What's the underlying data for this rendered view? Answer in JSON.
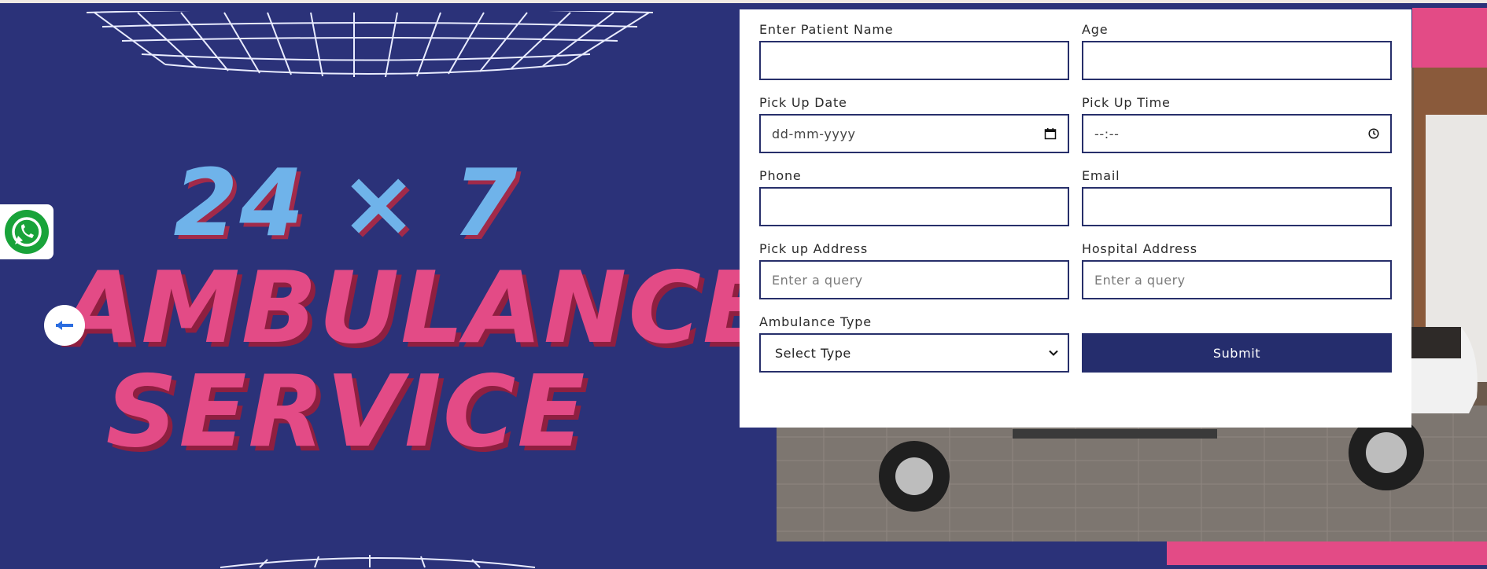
{
  "hero": {
    "title_line1": "24 × 7",
    "title_line2": "AMBULANCE",
    "title_line3": "SERVICE"
  },
  "icons": {
    "whatsapp": "whatsapp-icon",
    "prev": "arrow-left-icon",
    "calendar": "calendar-icon",
    "clock": "clock-icon",
    "chevron": "chevron-down-icon"
  },
  "colors": {
    "navy": "#2b3279",
    "pink": "#e34b86",
    "sky": "#6fb3ea",
    "button": "#252d6d"
  },
  "form": {
    "patient_name": {
      "label": "Enter Patient Name",
      "value": ""
    },
    "age": {
      "label": "Age",
      "value": ""
    },
    "pickup_date": {
      "label": "Pick Up Date",
      "placeholder": "dd-mm-yyyy"
    },
    "pickup_time": {
      "label": "Pick Up Time",
      "placeholder": "--:--"
    },
    "phone": {
      "label": "Phone",
      "value": ""
    },
    "email": {
      "label": "Email",
      "value": ""
    },
    "pickup_address": {
      "label": "Pick up Address",
      "placeholder": "Enter a query"
    },
    "hospital_address": {
      "label": "Hospital Address",
      "placeholder": "Enter a query"
    },
    "ambulance_type": {
      "label": "Ambulance Type",
      "selected": "Select Type"
    },
    "submit_label": "Submit"
  }
}
